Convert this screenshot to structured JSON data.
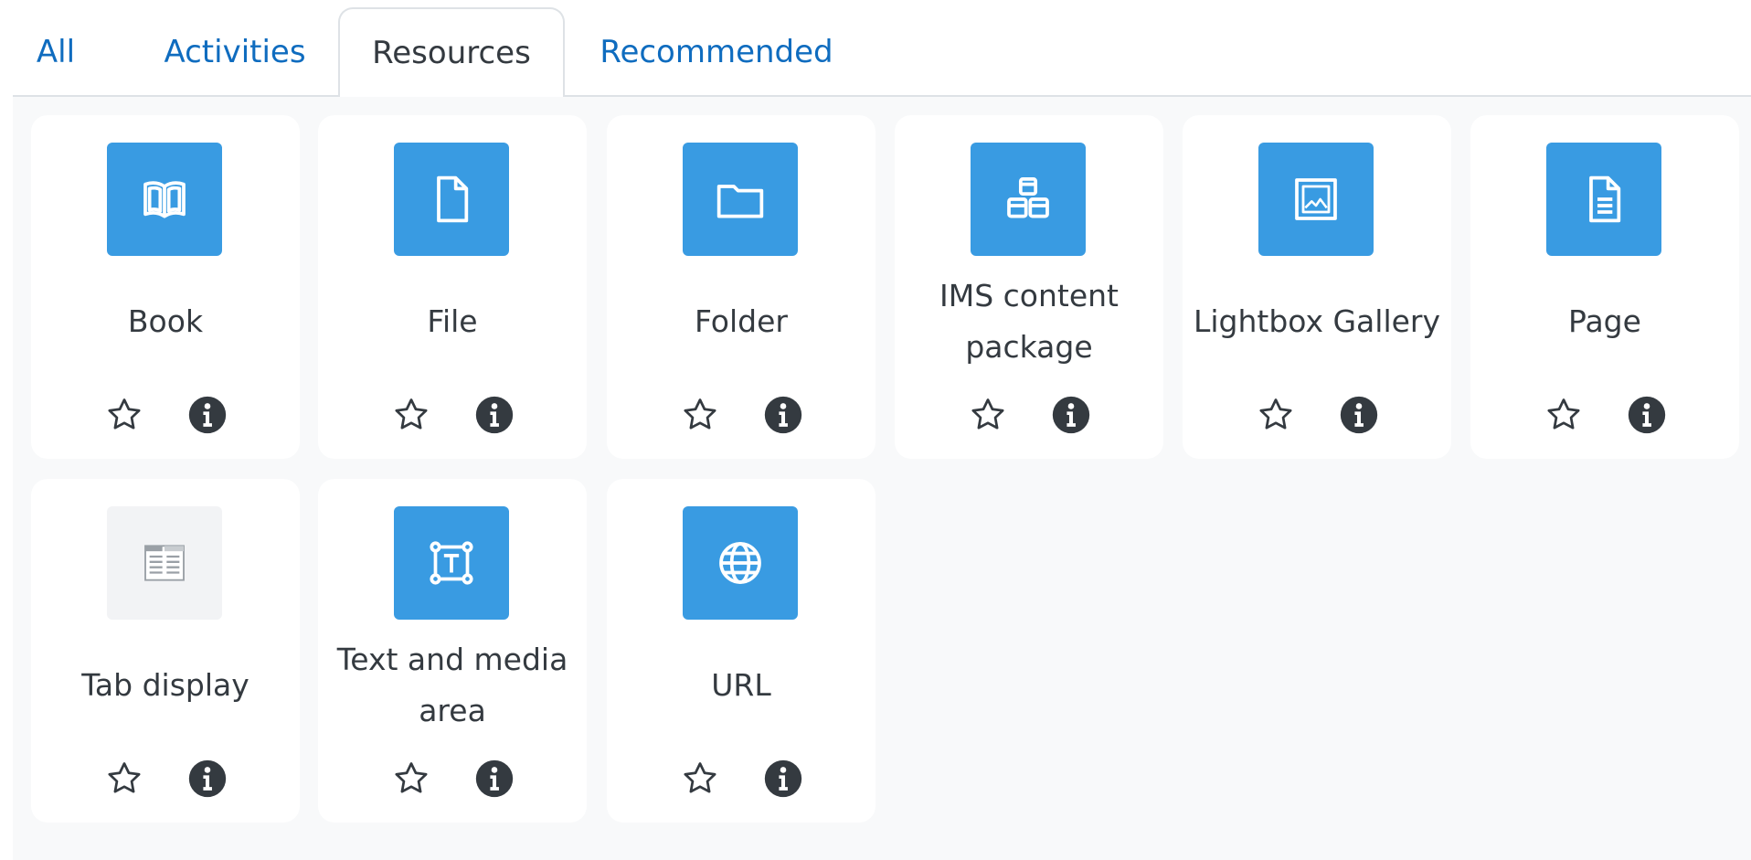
{
  "tabs": [
    {
      "label": "All",
      "active": false
    },
    {
      "label": "Activities",
      "active": false
    },
    {
      "label": "Resources",
      "active": true
    },
    {
      "label": "Recommended",
      "active": false
    }
  ],
  "modules": [
    {
      "name": "Book",
      "icon": "book-icon"
    },
    {
      "name": "File",
      "icon": "file-icon"
    },
    {
      "name": "Folder",
      "icon": "folder-icon"
    },
    {
      "name": "IMS content package",
      "icon": "package-icon"
    },
    {
      "name": "Lightbox Gallery",
      "icon": "gallery-icon"
    },
    {
      "name": "Page",
      "icon": "page-icon"
    },
    {
      "name": "Tab display",
      "icon": "tab-display-icon"
    },
    {
      "name": "Text and media area",
      "icon": "text-media-icon"
    },
    {
      "name": "URL",
      "icon": "globe-icon"
    }
  ],
  "colors": {
    "accent": "#0f6cbf",
    "icon_bg": "#399be2",
    "grid_bg": "#f8f9fa",
    "text": "#343a40"
  }
}
